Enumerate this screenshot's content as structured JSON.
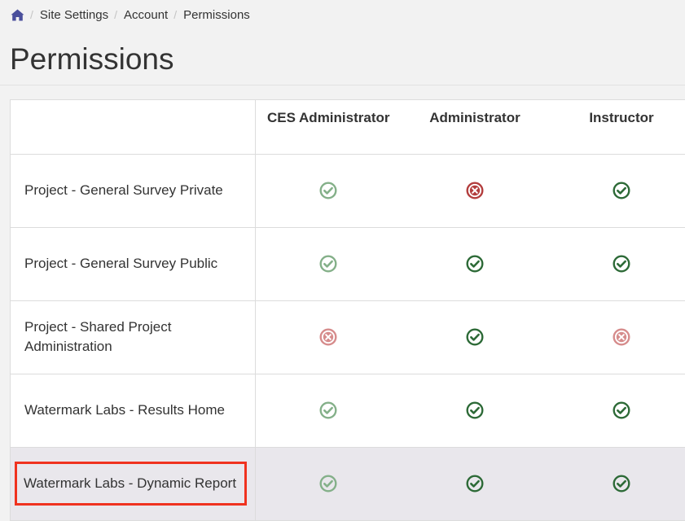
{
  "breadcrumb": {
    "home_icon": "home-icon",
    "items": [
      "Site Settings",
      "Account",
      "Permissions"
    ],
    "separator": "/"
  },
  "page": {
    "title": "Permissions"
  },
  "colors": {
    "granted_dark": "#2d6a37",
    "granted_light": "#84b089",
    "denied_dark": "#b33e3e",
    "denied_light": "#d68c8c",
    "selected_row": "#e9e7ec",
    "highlight_box": "#f0321f"
  },
  "table": {
    "columns": [
      "CES Administrator",
      "Administrator",
      "Instructor"
    ],
    "rows": [
      {
        "label": "Project - General Survey Private",
        "cells": [
          {
            "status": "granted",
            "shade": "light",
            "icon": "check-circle-icon"
          },
          {
            "status": "denied",
            "shade": "dark",
            "icon": "x-circle-icon"
          },
          {
            "status": "granted",
            "shade": "dark",
            "icon": "check-circle-icon"
          }
        ]
      },
      {
        "label": "Project - General Survey Public",
        "cells": [
          {
            "status": "granted",
            "shade": "light",
            "icon": "check-circle-icon"
          },
          {
            "status": "granted",
            "shade": "dark",
            "icon": "check-circle-icon"
          },
          {
            "status": "granted",
            "shade": "dark",
            "icon": "check-circle-icon"
          }
        ]
      },
      {
        "label": "Project - Shared Project Administration",
        "cells": [
          {
            "status": "denied",
            "shade": "light",
            "icon": "x-circle-icon"
          },
          {
            "status": "granted",
            "shade": "dark",
            "icon": "check-circle-icon"
          },
          {
            "status": "denied",
            "shade": "light",
            "icon": "x-circle-icon"
          }
        ]
      },
      {
        "label": "Watermark Labs - Results Home",
        "cells": [
          {
            "status": "granted",
            "shade": "light",
            "icon": "check-circle-icon"
          },
          {
            "status": "granted",
            "shade": "dark",
            "icon": "check-circle-icon"
          },
          {
            "status": "granted",
            "shade": "dark",
            "icon": "check-circle-icon"
          }
        ]
      },
      {
        "label": "Watermark Labs - Dynamic Report",
        "selected": true,
        "cells": [
          {
            "status": "granted",
            "shade": "light",
            "icon": "check-circle-icon"
          },
          {
            "status": "granted",
            "shade": "dark",
            "icon": "check-circle-icon"
          },
          {
            "status": "granted",
            "shade": "dark",
            "icon": "check-circle-icon"
          }
        ]
      }
    ]
  }
}
